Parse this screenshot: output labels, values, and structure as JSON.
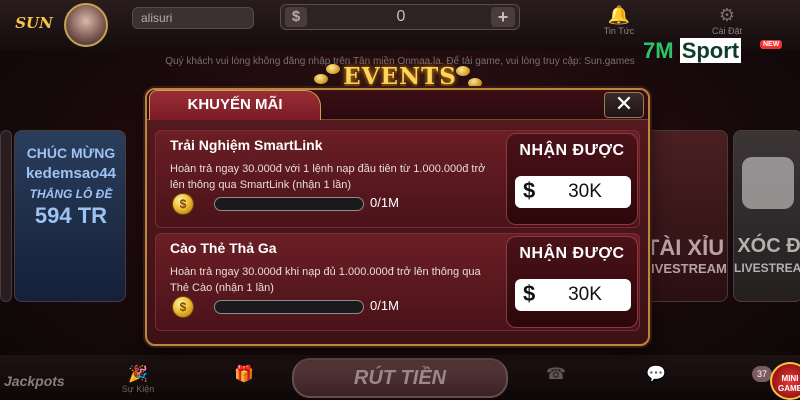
{
  "header": {
    "logo_text": "SUN",
    "username": "alisuri",
    "balance_currency": "$",
    "balance_value": "0",
    "add_label": "+",
    "news_label": "Tin Tức",
    "settings_label": "Cài Đặt"
  },
  "notice": "Quý khách vui lòng không đăng nhập trên Tân miền Onmaa.la. Để tải game, vui lòng truy cập: Sun.games",
  "brand": {
    "seven_m": "7M",
    "sport": "Sport",
    "badge": "NEW"
  },
  "background_tiles": {
    "left": {
      "line1": "CHÚC MỪNG",
      "line2": "kedemsao44",
      "line3": "THẮNG LÔ ĐỀ",
      "line4": "594 TR"
    },
    "right1": {
      "line1": "TÀI XỈU",
      "line2": "LIVESTREAM"
    },
    "right2": {
      "line1": "XÓC Đ",
      "line2": "LIVESTREAM"
    }
  },
  "events_label": "EVENTS",
  "dialog": {
    "tab_label": "KHUYẾN MÃI",
    "close_label": "✕",
    "promos": [
      {
        "title": "Trải Nghiệm SmartLink",
        "description": "Hoàn trả ngay 30.000đ với 1 lệnh nạp đầu tiên từ 1.000.000đ trở lên thông qua SmartLink (nhận 1 lần)",
        "progress_text": "0/1M",
        "progress_fraction": 0,
        "claim_label": "NHẬN ĐƯỢC",
        "reward_currency": "$",
        "reward_value": "30K"
      },
      {
        "title": "Cào Thẻ Thả Ga",
        "description": "Hoàn trả ngay 30.000đ khi nạp đủ 1.000.000đ trở lên thông qua Thẻ Cào (nhận 1 lần)",
        "progress_text": "0/1M",
        "progress_fraction": 0,
        "claim_label": "NHẬN ĐƯỢC",
        "reward_currency": "$",
        "reward_value": "30K"
      }
    ]
  },
  "bottom": {
    "jackpot_label": "Jackpots",
    "event_label": "Sự Kiện",
    "withdraw_label": "RÚT TIỀN",
    "mini_count": "37",
    "mini_game_label": "MINI GAME"
  },
  "colors": {
    "dialog_bg": "#561a1f",
    "dialog_border": "#b9883f",
    "events_gold": "#ffd85a",
    "brand_green": "#2cc36b"
  }
}
